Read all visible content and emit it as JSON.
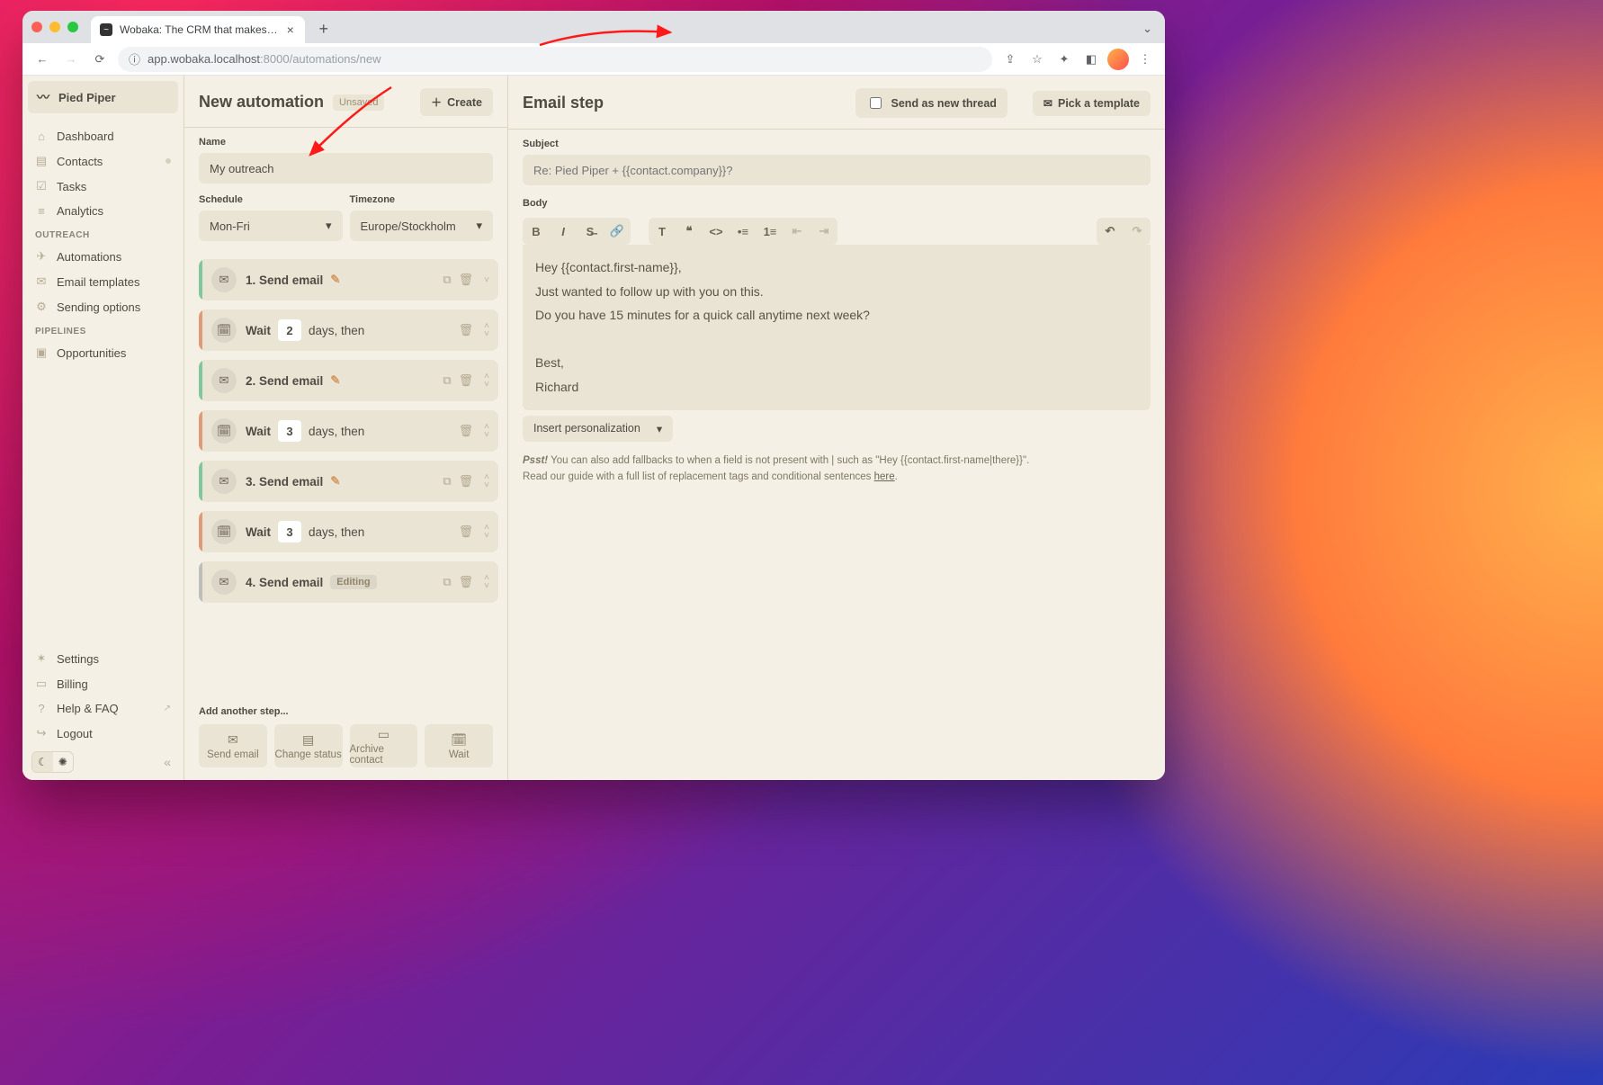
{
  "browser": {
    "tab_title": "Wobaka: The CRM that makes…",
    "url_host": "app.wobaka.localhost",
    "url_port": ":8000",
    "url_path": "/automations/new"
  },
  "workspace": "Pied Piper",
  "sidebar": {
    "main": [
      {
        "icon": "⌂",
        "label": "Dashboard"
      },
      {
        "icon": "▤",
        "label": "Contacts",
        "dot": true
      },
      {
        "icon": "☑",
        "label": "Tasks"
      },
      {
        "icon": "≡",
        "label": "Analytics"
      }
    ],
    "outreach_title": "OUTREACH",
    "outreach": [
      {
        "icon": "✈",
        "label": "Automations"
      },
      {
        "icon": "✉",
        "label": "Email templates"
      },
      {
        "icon": "⚙",
        "label": "Sending options"
      }
    ],
    "pipelines_title": "PIPELINES",
    "pipelines": [
      {
        "icon": "▣",
        "label": "Opportunities"
      }
    ],
    "bottom": [
      {
        "icon": "✶",
        "label": "Settings"
      },
      {
        "icon": "▭",
        "label": "Billing"
      },
      {
        "icon": "?",
        "label": "Help & FAQ",
        "ext": true
      },
      {
        "icon": "↪",
        "label": "Logout"
      }
    ]
  },
  "left": {
    "title": "New automation",
    "unsaved": "Unsaved",
    "create": "Create",
    "name_label": "Name",
    "name_value": "My outreach",
    "schedule_label": "Schedule",
    "schedule_value": "Mon-Fri",
    "timezone_label": "Timezone",
    "timezone_value": "Europe/Stockholm",
    "steps": [
      {
        "type": "email",
        "label": "1. Send email",
        "selected": true
      },
      {
        "type": "wait",
        "days": "2",
        "rest": "days, then"
      },
      {
        "type": "email",
        "label": "2. Send email"
      },
      {
        "type": "wait",
        "days": "3",
        "rest": "days, then"
      },
      {
        "type": "email",
        "label": "3. Send email"
      },
      {
        "type": "wait",
        "days": "3",
        "rest": "days, then"
      },
      {
        "type": "email",
        "label": "4. Send email",
        "editing": "Editing"
      }
    ],
    "add_label": "Add another step...",
    "add_buttons": [
      "Send email",
      "Change status",
      "Archive contact",
      "Wait"
    ],
    "wait_word": "Wait"
  },
  "right": {
    "title": "Email step",
    "send_new_thread": "Send as new thread",
    "pick_template": "Pick a template",
    "subject_label": "Subject",
    "subject_placeholder": "Re: Pied Piper + {{contact.company}}?",
    "body_label": "Body",
    "body_lines": [
      "Hey {{contact.first-name}},",
      "Just wanted to follow up with you on this.",
      "Do you have 15 minutes for a quick call anytime next week?",
      "",
      "Best,",
      "Richard"
    ],
    "insert": "Insert personalization",
    "psst_strong": "Psst!",
    "psst_text": " You can also add fallbacks to when a field is not present with | such as \"Hey {{contact.first-name|there}}\".",
    "psst_line2": "Read our guide with a full list of replacement tags and conditional sentences ",
    "psst_link": "here"
  }
}
